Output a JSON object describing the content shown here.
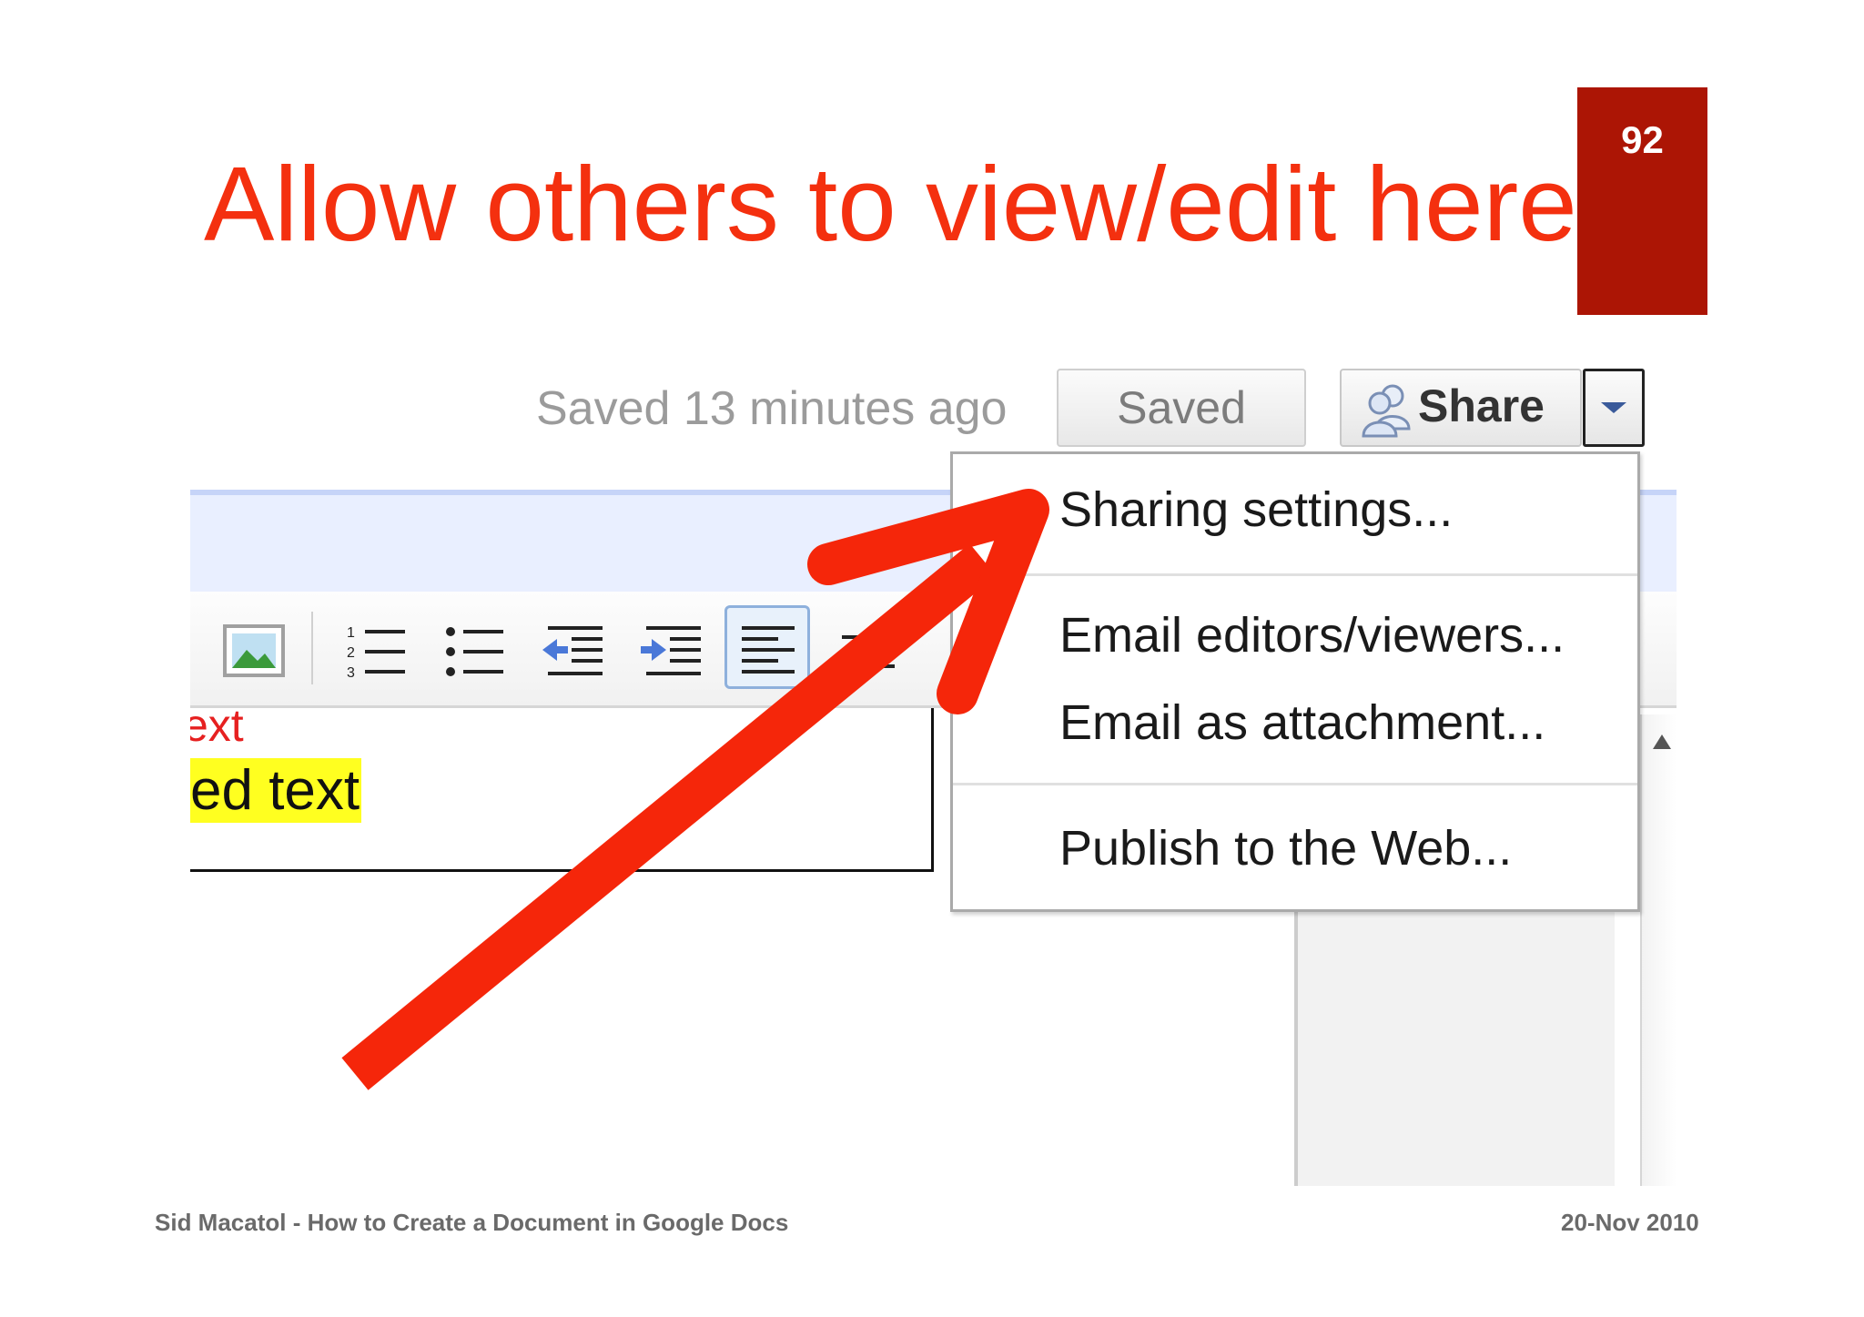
{
  "slide": {
    "title": "Allow others to view/edit here",
    "page_number": "92",
    "footer_left": "Sid Macatol - How to Create a Document in Google Docs",
    "footer_right": "20-Nov 2010"
  },
  "docs_header": {
    "saved_status": "Saved 13 minutes ago",
    "saved_button_label": "Saved",
    "share_button_label": "Share",
    "share_icon": "people-icon",
    "dropdown_icon": "chevron-down-icon"
  },
  "toolbar": {
    "icons": [
      "insert-image-icon",
      "numbered-list-icon",
      "bulleted-list-icon",
      "decrease-indent-icon",
      "increase-indent-icon",
      "align-left-icon"
    ],
    "active_icon": "align-left-icon"
  },
  "document": {
    "fragment_red": "ext",
    "fragment_highlighted": "ed text"
  },
  "share_menu": {
    "items": [
      {
        "label": "Sharing settings..."
      },
      {
        "label": "Email editors/viewers..."
      },
      {
        "label": "Email as attachment..."
      },
      {
        "label": "Publish to the Web..."
      }
    ]
  },
  "colors": {
    "title": "#f4300f",
    "badge": "#ac1505",
    "arrow": "#f5260a",
    "highlight": "#ffff20"
  }
}
